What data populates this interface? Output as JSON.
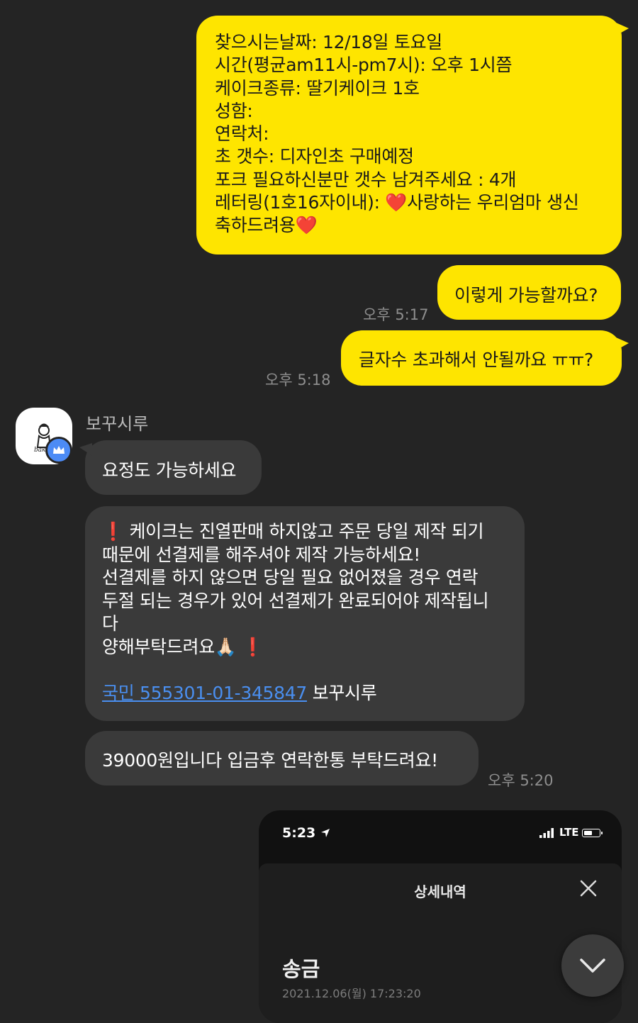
{
  "messages": {
    "order_form": {
      "line1": "찾으시는날짜: 12/18일 토요일",
      "line2": "시간(평균am11시-pm7시): 오후 1시쯤",
      "line3": "케이크종류: 딸기케이크 1호",
      "line4": "성함:",
      "line5": "연락처:",
      "line6": "초 갯수: 디자인초 구매예정",
      "line7": "포크 필요하신분만 갯수 남겨주세요 : 4개",
      "line8_prefix": "레터링(1호16자이내): ",
      "line8_suffix": "사랑하는 우리엄마 생신",
      "line9": "축하드려용",
      "heart_emoji": "❤️"
    },
    "question1": "이렇게 가능할까요?",
    "question1_time": "오후 5:17",
    "question2": "글자수 초과해서 안될까요 ㅠㅠ?",
    "question2_time": "오후 5:18",
    "sender_name": "보꾸시루",
    "reply1": "요정도 가능하세요",
    "notice": {
      "line1": "케이크는 진열판매 하지않고 주문 당일 제작 되기",
      "line2": "때문에 선결제를 해주셔야 제작 가능하세요!",
      "line3": "선결제를 하지 않으면 당일 필요 없어졌을 경우 연락",
      "line4": "두절 되는 경우가 있어 선결제가 완료되어야 제작됩니",
      "line5": "다",
      "line6": "양해부탁드려요",
      "exclamation": "❗",
      "pray_emoji": "🙏🏻",
      "account_link": "국민 555301-01-345847",
      "account_holder": "보꾸시루"
    },
    "price_message": "39000원입니다 입금후 연락한통 부탁드려요!",
    "price_time": "오후 5:20"
  },
  "screenshot": {
    "status_time": "5:23",
    "network": "LTE",
    "panel_title": "상세내역",
    "transaction_type": "송금",
    "transaction_datetime": "2021.12.06(월) 17:23:20"
  },
  "icons": {
    "avatar": "bakery-logo-avatar",
    "badge": "crown-badge-icon",
    "close": "close-icon",
    "scroll_down": "chevron-down-icon",
    "location": "location-arrow-icon",
    "signal": "signal-bars-icon",
    "battery": "battery-icon"
  },
  "colors": {
    "background": "#242424",
    "my_bubble": "#fee500",
    "other_bubble": "#3a3a3a",
    "link": "#4a8ff0",
    "badge": "#4c8bf5"
  }
}
